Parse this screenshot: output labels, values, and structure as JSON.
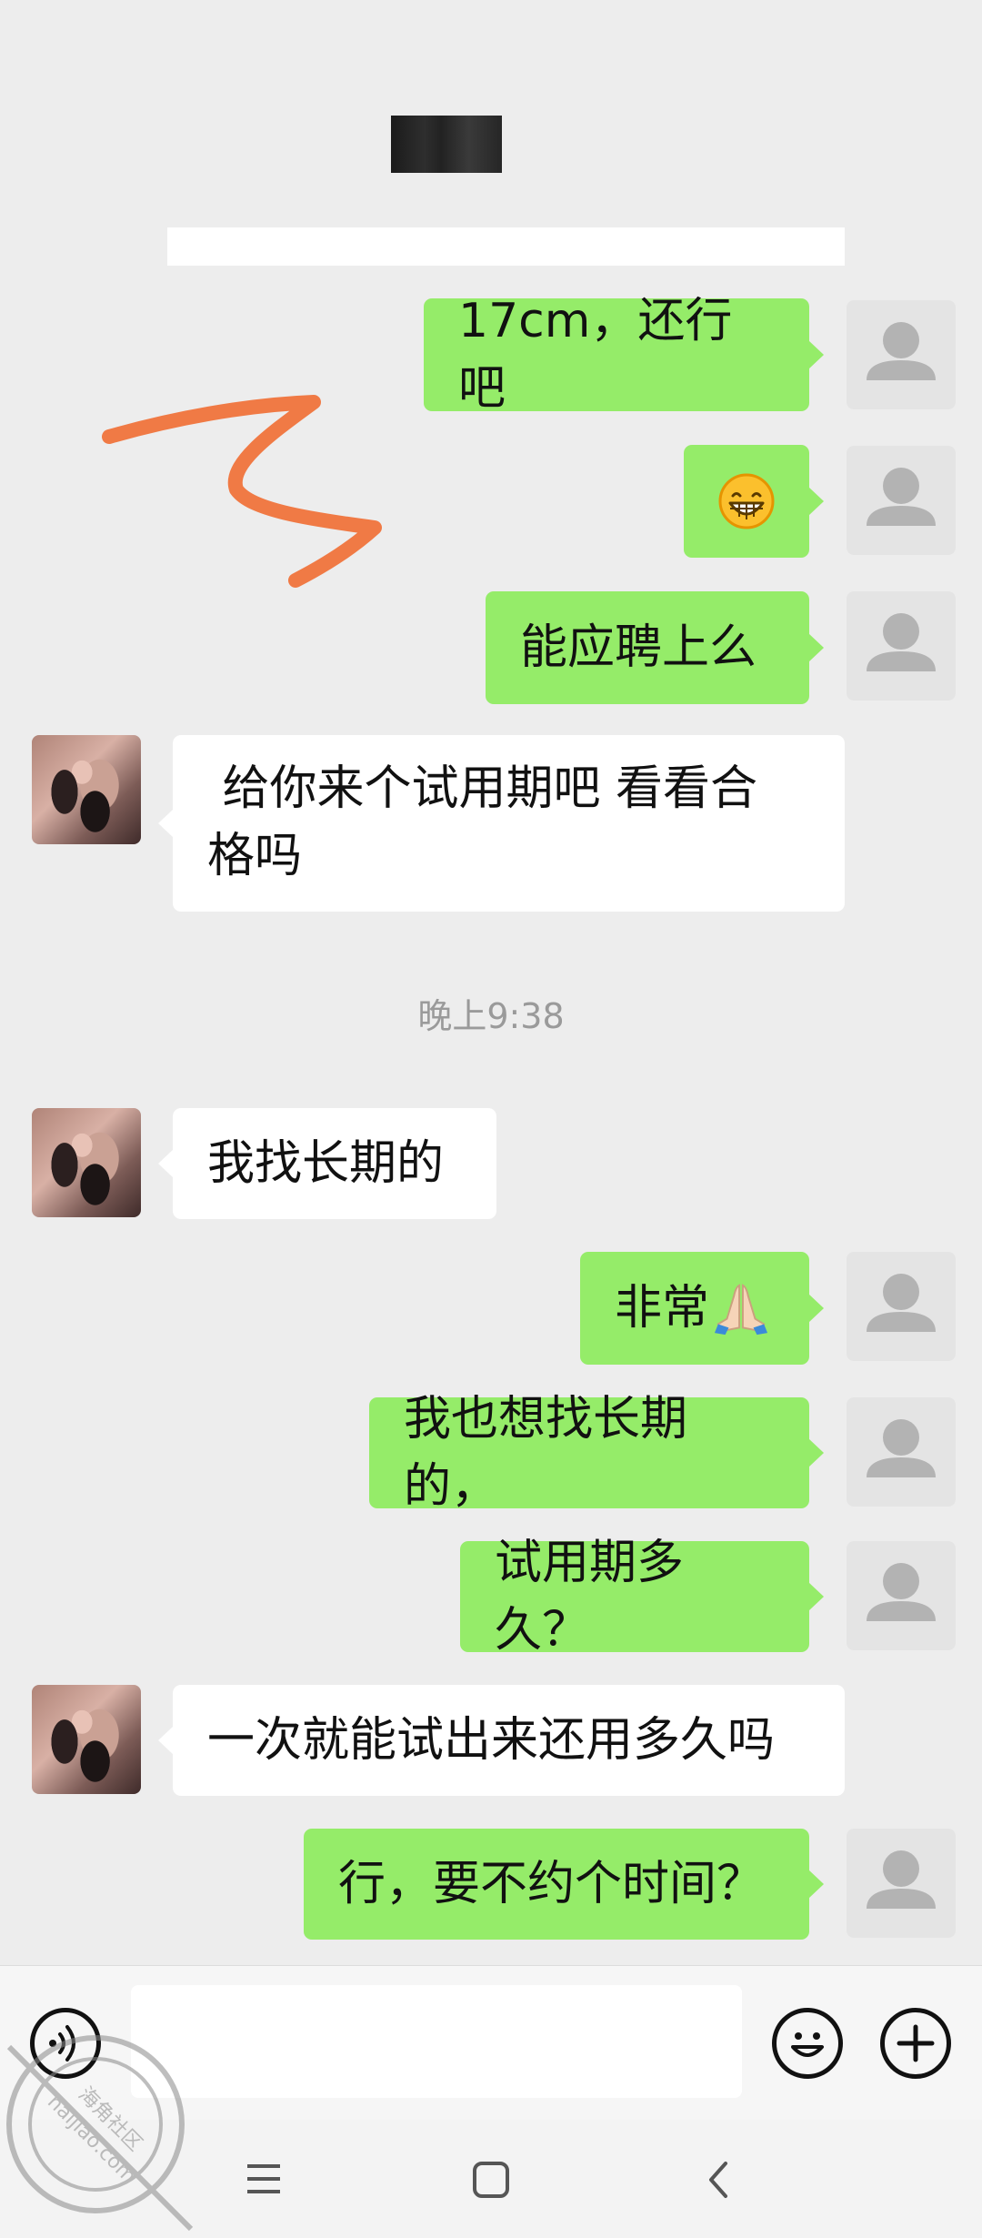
{
  "chat": {
    "title_redacted": true,
    "timestamp": "晚上9:38",
    "messages": [
      {
        "dir": "out",
        "text": "17cm，还行吧"
      },
      {
        "dir": "out",
        "emoji": "grinning-face"
      },
      {
        "dir": "out",
        "text": "能应聘上么"
      },
      {
        "dir": "in",
        "line1": " 给你来个试用期吧 看看合",
        "line2": "格吗"
      },
      {
        "dir": "in",
        "text": "我找长期的"
      },
      {
        "dir": "out",
        "text": "非常",
        "emoji": "folded-hands"
      },
      {
        "dir": "out",
        "text": "我也想找长期的，"
      },
      {
        "dir": "out",
        "text": "试用期多久？"
      },
      {
        "dir": "in",
        "text": "一次就能试出来还用多久吗"
      },
      {
        "dir": "out",
        "text": "行，要不约个时间？"
      }
    ]
  },
  "input": {
    "voice_icon": "voice-icon",
    "emoji_icon": "emoji-icon",
    "plus_icon": "plus-icon",
    "value": ""
  },
  "nav": {
    "menu_icon": "menu-icon",
    "home_icon": "home-icon",
    "back_icon": "back-icon"
  },
  "watermark": {
    "text_cn": "海角社区",
    "text_en": "haijiao.com"
  },
  "colors": {
    "background": "#ededed",
    "outgoing_bubble": "#95ec69",
    "incoming_bubble": "#ffffff",
    "scribble": "#f07a45"
  }
}
